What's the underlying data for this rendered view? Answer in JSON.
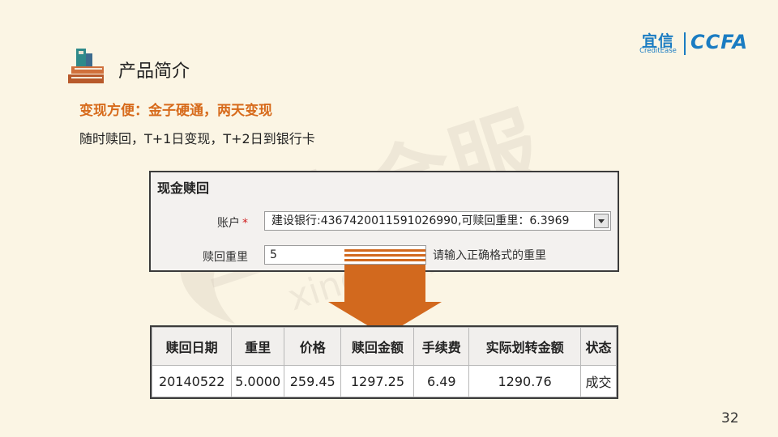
{
  "header": {
    "title": "产品简介",
    "logo_cn": "宜信",
    "logo_en": "CreditEase",
    "logo_ccfa": "CCFA"
  },
  "watermark": {
    "text_cn": "星火金服",
    "text_url": "xinghuojinfu.com"
  },
  "intro": {
    "subtitle": "变现方便：金子硬通，两天变现",
    "line": "随时赎回，T+1日变现，T+2日到银行卡"
  },
  "redeem_form": {
    "title": "现金赎回",
    "account_label": "账户",
    "required_mark": "*",
    "account_value": "建设银行:4367420011591026990,可赎回重里：6.3969",
    "weight_label": "赎回重里",
    "weight_value": "5",
    "hint": "请输入正确格式的重里"
  },
  "result_table": {
    "columns": [
      "赎回日期",
      "重里",
      "价格",
      "赎回金额",
      "手续费",
      "实际划转金额",
      "状态"
    ],
    "rows": [
      [
        "20140522",
        "5.0000",
        "259.45",
        "1297.25",
        "6.49",
        "1290.76",
        "成交"
      ]
    ]
  },
  "page_number": "32",
  "colors": {
    "background": "#fbf5e4",
    "accent_orange": "#d76b1c",
    "arrow_orange": "#d2691e",
    "brand_blue": "#1a7cc2"
  }
}
